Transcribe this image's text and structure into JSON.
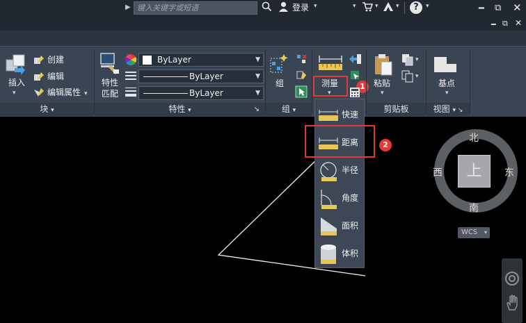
{
  "titlebar": {
    "search_placeholder": "键入关键字或短语",
    "login_label": "登录"
  },
  "ribbon": {
    "insert_label": "插入",
    "create_label": "创建",
    "edit_label": "编辑",
    "edit_attr_label": "编辑属性",
    "block_footer": "块",
    "match_props_line1": "特性",
    "match_props_line2": "匹配",
    "layer_color": "ByLayer",
    "layer_linetype": "ByLayer",
    "layer_lineweight": "ByLayer",
    "properties_footer": "特性",
    "group_label": "组",
    "group_footer": "组",
    "measure_label": "测量",
    "paste_label": "粘贴",
    "clipboard_footer": "剪贴板",
    "basepoint_label": "基点",
    "view_footer": "视图"
  },
  "annotations": {
    "badge_1": "1",
    "badge_2": "2"
  },
  "measure_menu": {
    "items": [
      {
        "label": "快速",
        "icon": "ruler-quick-icon"
      },
      {
        "label": "距离",
        "icon": "ruler-distance-icon"
      },
      {
        "label": "半径",
        "icon": "radius-icon"
      },
      {
        "label": "角度",
        "icon": "angle-icon"
      },
      {
        "label": "面积",
        "icon": "area-icon"
      },
      {
        "label": "体积",
        "icon": "volume-icon"
      }
    ]
  },
  "viewcube": {
    "north": "北",
    "south": "南",
    "east": "东",
    "west": "西",
    "top_face": "上",
    "wcs_label": "WCS"
  },
  "colors": {
    "ribbon_bg": "#3a4554",
    "titlebar_bg": "#212831",
    "highlight": "#e53935",
    "ruler_yellow": "#e8c65a"
  }
}
